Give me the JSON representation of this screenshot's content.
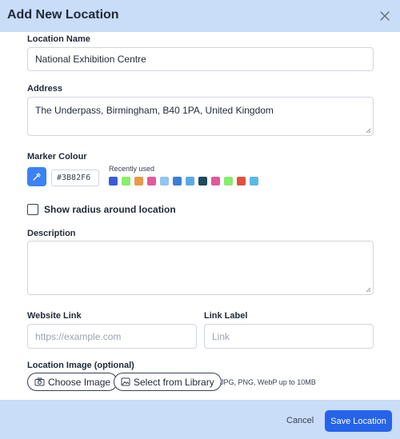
{
  "header": {
    "title": "Add New Location"
  },
  "form": {
    "name": {
      "label": "Location Name",
      "value": "National Exhibition Centre"
    },
    "address": {
      "label": "Address",
      "value": "The Underpass, Birmingham, B40 1PA, United Kingdom"
    },
    "marker": {
      "label": "Marker Colour",
      "hex": "#3B82F6",
      "recent_label": "Recently used",
      "recent_colors": [
        "#3b5bdb",
        "#86ef6c",
        "#ea9a4a",
        "#e05a9a",
        "#93c5f0",
        "#3b7dd8",
        "#5aa9e6",
        "#1e4a5f",
        "#e05a9a",
        "#86ef6c",
        "#e0503c",
        "#5ab8e6"
      ]
    },
    "radius": {
      "label": "Show radius around location",
      "checked": false
    },
    "description": {
      "label": "Description",
      "value": ""
    },
    "website": {
      "label": "Website Link",
      "placeholder": "https://example.com"
    },
    "link_label": {
      "label": "Link Label",
      "placeholder": "Link"
    },
    "image": {
      "label": "Location Image (optional)",
      "choose": "Choose Image",
      "library": "Select from Library",
      "hint": "JPG, PNG, WebP up to 10MB"
    }
  },
  "footer": {
    "cancel": "Cancel",
    "save": "Save Location"
  }
}
